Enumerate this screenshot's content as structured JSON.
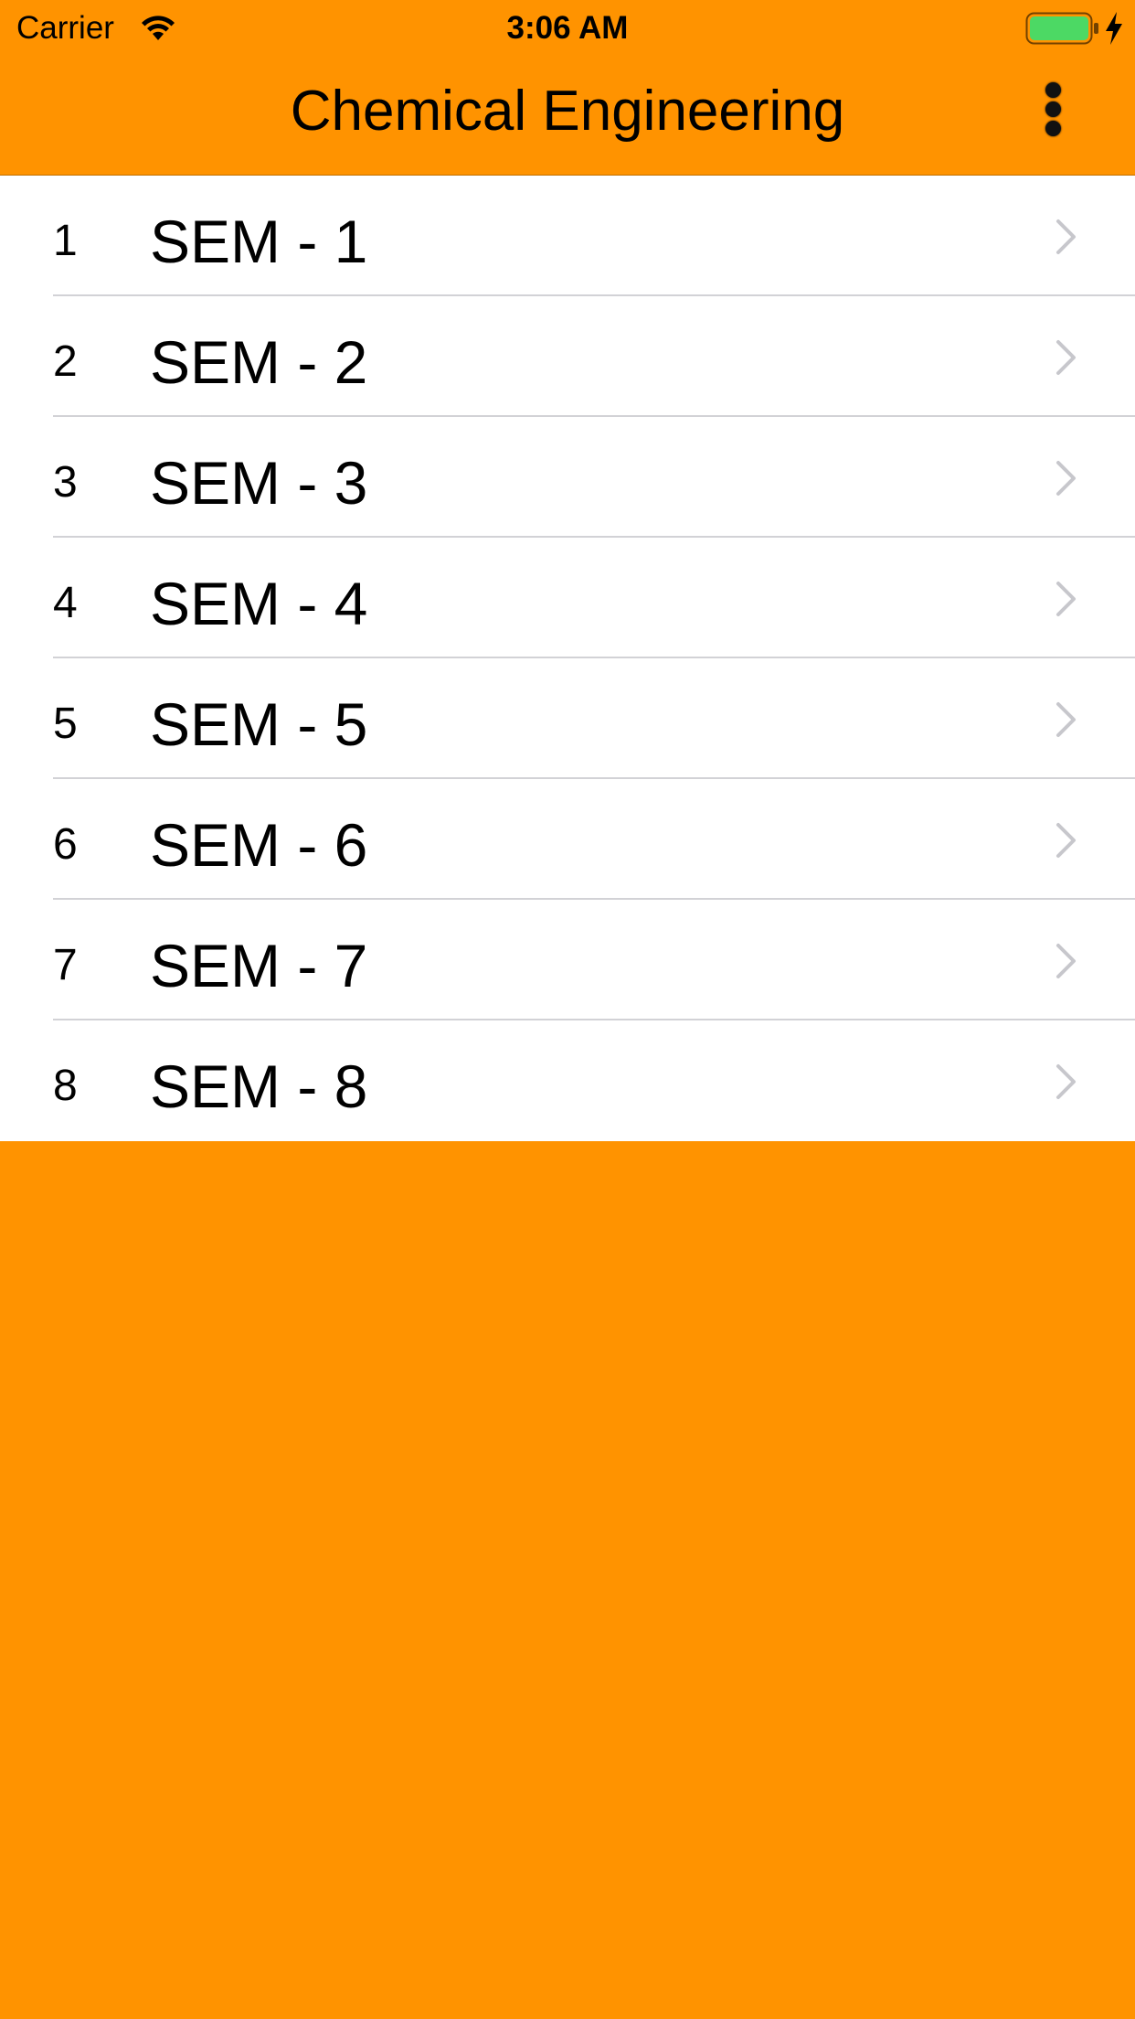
{
  "status_bar": {
    "carrier": "Carrier",
    "time": "3:06 AM",
    "icons": [
      "wifi-icon",
      "battery-icon",
      "charging-bolt-icon"
    ],
    "battery_color": "#4CD964"
  },
  "nav_bar": {
    "title": "Chemical Engineering",
    "more_icon": "more-vertical-icon"
  },
  "semesters": [
    {
      "number": "1",
      "label": "SEM - 1"
    },
    {
      "number": "2",
      "label": "SEM - 2"
    },
    {
      "number": "3",
      "label": "SEM - 3"
    },
    {
      "number": "4",
      "label": "SEM - 4"
    },
    {
      "number": "5",
      "label": "SEM - 5"
    },
    {
      "number": "6",
      "label": "SEM - 6"
    },
    {
      "number": "7",
      "label": "SEM - 7"
    },
    {
      "number": "8",
      "label": "SEM - 8"
    }
  ],
  "colors": {
    "accent": "#FF9300",
    "list_background": "#FFFFFF",
    "chevron": "#C7C7CC"
  }
}
